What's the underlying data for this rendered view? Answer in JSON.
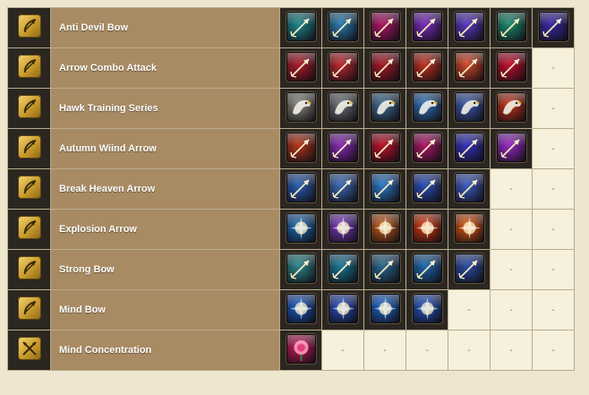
{
  "empty_marker": "-",
  "rows": [
    {
      "name": "Anti Devil Bow",
      "cat_icon": "bow-category-icon",
      "skills": [
        {
          "icon": "arrow-skill-icon",
          "color": "#1d8a8e"
        },
        {
          "icon": "arrow-skill-icon",
          "color": "#2a7fb0"
        },
        {
          "icon": "arrow-skill-icon",
          "color": "#b0186a"
        },
        {
          "icon": "arrow-skill-icon",
          "color": "#7a2cc0"
        },
        {
          "icon": "arrow-skill-icon",
          "color": "#5a3bc4"
        },
        {
          "icon": "arrow-skill-icon",
          "color": "#1c8f6e"
        },
        {
          "icon": "arrow-skill-icon",
          "color": "#3b2aa8"
        }
      ]
    },
    {
      "name": "Arrow Combo Attack",
      "cat_icon": "bow-category-icon",
      "skills": [
        {
          "icon": "arrow-skill-icon",
          "color": "#b01c2a"
        },
        {
          "icon": "arrow-skill-icon",
          "color": "#c02830"
        },
        {
          "icon": "arrow-skill-icon",
          "color": "#a81c26"
        },
        {
          "icon": "arrow-skill-icon",
          "color": "#c43222"
        },
        {
          "icon": "arrow-skill-icon",
          "color": "#d64a28"
        },
        {
          "icon": "arrow-skill-icon",
          "color": "#c8102e"
        }
      ]
    },
    {
      "name": "Hawk Training Series",
      "cat_icon": "bow-category-icon",
      "skills": [
        {
          "icon": "hawk-skill-icon",
          "color": "#8a8a80"
        },
        {
          "icon": "hawk-skill-icon",
          "color": "#6e7478"
        },
        {
          "icon": "hawk-skill-icon",
          "color": "#3f6e90"
        },
        {
          "icon": "hawk-skill-icon",
          "color": "#2f72b8"
        },
        {
          "icon": "hawk-skill-icon",
          "color": "#3a5fb0"
        },
        {
          "icon": "hawk-skill-icon",
          "color": "#c8361c"
        }
      ]
    },
    {
      "name": "Autumn Wiind Arrow",
      "cat_icon": "bow-category-icon",
      "skills": [
        {
          "icon": "arrow-skill-icon",
          "color": "#b8361c"
        },
        {
          "icon": "arrow-skill-icon",
          "color": "#8a2cb8"
        },
        {
          "icon": "arrow-skill-icon",
          "color": "#c0142a"
        },
        {
          "icon": "arrow-skill-icon",
          "color": "#b0186a"
        },
        {
          "icon": "arrow-skill-icon",
          "color": "#3434c0"
        },
        {
          "icon": "arrow-skill-icon",
          "color": "#9a2cc8"
        }
      ]
    },
    {
      "name": "Break Heaven Arrow",
      "cat_icon": "bow-category-icon",
      "skills": [
        {
          "icon": "arrow-skill-icon",
          "color": "#2a5fb4"
        },
        {
          "icon": "arrow-skill-icon",
          "color": "#3a6ab8"
        },
        {
          "icon": "arrow-skill-icon",
          "color": "#2c7ac8"
        },
        {
          "icon": "arrow-skill-icon",
          "color": "#2a4fb8"
        },
        {
          "icon": "arrow-skill-icon",
          "color": "#3c5cc4"
        }
      ]
    },
    {
      "name": "Explosion Arrow",
      "cat_icon": "bow-category-icon",
      "skills": [
        {
          "icon": "burst-skill-icon",
          "color": "#1d6fb8"
        },
        {
          "icon": "burst-skill-icon",
          "color": "#7a3cc0"
        },
        {
          "icon": "burst-skill-icon",
          "color": "#c8601c"
        },
        {
          "icon": "burst-skill-icon",
          "color": "#d83a10"
        },
        {
          "icon": "burst-skill-icon",
          "color": "#e05a10"
        }
      ]
    },
    {
      "name": "Strong Bow",
      "cat_icon": "bow-category-icon",
      "skills": [
        {
          "icon": "arrow-skill-icon",
          "color": "#2a8a8e"
        },
        {
          "icon": "arrow-skill-icon",
          "color": "#1c7a9a"
        },
        {
          "icon": "arrow-skill-icon",
          "color": "#2a6a8e"
        },
        {
          "icon": "arrow-skill-icon",
          "color": "#1c6ab0"
        },
        {
          "icon": "arrow-skill-icon",
          "color": "#2a4fa8"
        }
      ]
    },
    {
      "name": "Mind Bow",
      "cat_icon": "bow-category-icon",
      "skills": [
        {
          "icon": "burst-skill-icon",
          "color": "#1c5cc8"
        },
        {
          "icon": "burst-skill-icon",
          "color": "#2a4fc0"
        },
        {
          "icon": "burst-skill-icon",
          "color": "#1c6ad0"
        },
        {
          "icon": "burst-skill-icon",
          "color": "#2458c8"
        }
      ]
    },
    {
      "name": "Mind Concentration",
      "cat_icon": "crossed-arrows-category-icon",
      "skills": [
        {
          "icon": "rose-skill-icon",
          "color": "#c81c5a"
        }
      ]
    }
  ]
}
